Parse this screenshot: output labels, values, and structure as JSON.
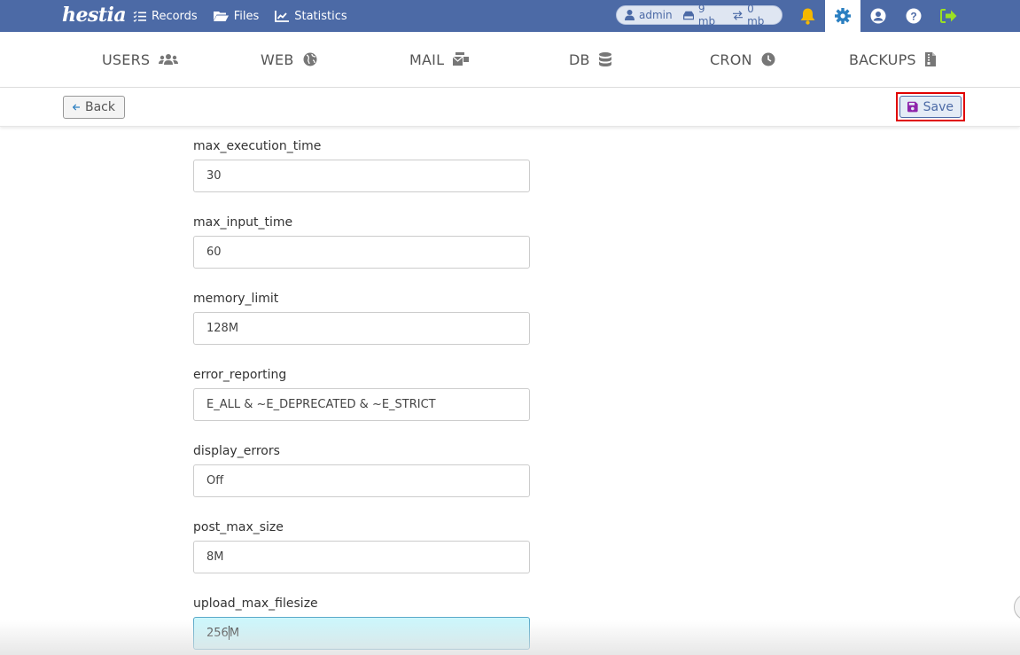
{
  "topbar": {
    "logo": "hestia",
    "nav": [
      {
        "label": "Records",
        "icon": "list-check-icon"
      },
      {
        "label": "Files",
        "icon": "folder-open-icon"
      },
      {
        "label": "Statistics",
        "icon": "chart-line-icon"
      }
    ],
    "user_pill": {
      "user": "admin",
      "disk": "9 mb",
      "bandwidth": "0 mb"
    },
    "icons": [
      "bell-icon",
      "gear-icon",
      "user-circle-icon",
      "help-icon",
      "logout-icon"
    ]
  },
  "tabs": [
    {
      "label": "USERS",
      "icon": "users-icon"
    },
    {
      "label": "WEB",
      "icon": "globe-icon"
    },
    {
      "label": "MAIL",
      "icon": "mail-bulk-icon"
    },
    {
      "label": "DB",
      "icon": "database-icon"
    },
    {
      "label": "CRON",
      "icon": "clock-icon"
    },
    {
      "label": "BACKUPS",
      "icon": "file-zipper-icon"
    }
  ],
  "toolbar": {
    "back_label": "Back",
    "save_label": "Save"
  },
  "form": {
    "fields": [
      {
        "label": "max_execution_time",
        "value": "30"
      },
      {
        "label": "max_input_time",
        "value": "60"
      },
      {
        "label": "memory_limit",
        "value": "128M"
      },
      {
        "label": "error_reporting",
        "value": "E_ALL & ~E_DEPRECATED & ~E_STRICT"
      },
      {
        "label": "display_errors",
        "value": "Off"
      },
      {
        "label": "post_max_size",
        "value": "8M"
      },
      {
        "label": "upload_max_filesize",
        "value_before_caret": "256",
        "value_after_caret": "M"
      }
    ]
  },
  "colors": {
    "topbar": "#4c6aa6",
    "bell": "#f5b800",
    "logout": "#9be023",
    "save_icon": "#8e24aa",
    "highlight": "#e00000",
    "focused_input": "#cdf6fb"
  }
}
